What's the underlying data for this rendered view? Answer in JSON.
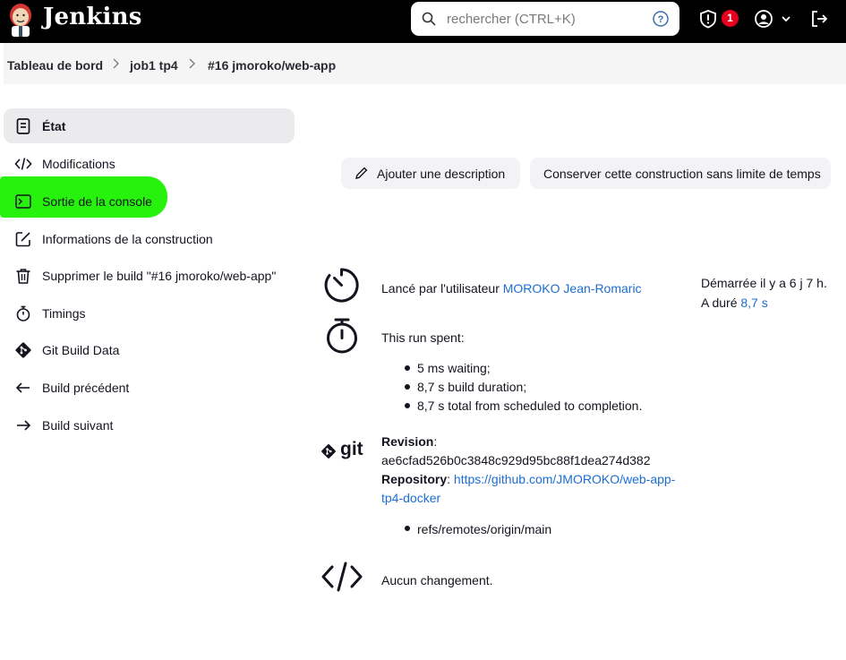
{
  "header": {
    "brand": "Jenkins",
    "search_placeholder": "rechercher (CTRL+K)",
    "security_badge_count": "1"
  },
  "breadcrumb": [
    "Tableau de bord",
    "job1 tp4",
    "#16 jmoroko/web-app"
  ],
  "sidebar": {
    "items": [
      {
        "label": "État",
        "icon": "document-icon"
      },
      {
        "label": "Modifications",
        "icon": "code-icon"
      },
      {
        "label": "Sortie de la console",
        "icon": "terminal-icon"
      },
      {
        "label": "Informations de la construction",
        "icon": "edit-icon"
      },
      {
        "label": "Supprimer le build \"#16 jmoroko/web-app\"",
        "icon": "trash-icon"
      },
      {
        "label": "Timings",
        "icon": "stopwatch-icon"
      },
      {
        "label": "Git Build Data",
        "icon": "git-icon"
      },
      {
        "label": "Build précédent",
        "icon": "arrow-left-icon"
      },
      {
        "label": "Build suivant",
        "icon": "arrow-right-icon"
      }
    ],
    "highlight_color": "#27f20e"
  },
  "actions": {
    "add_description": "Ajouter une description",
    "keep_build": "Conserver cette construction sans limite de temps"
  },
  "build": {
    "launched_by_prefix": "Lancé par l'utilisateur",
    "launched_by_user": "MOROKO Jean-Romaric",
    "started": "Démarrée il y a 6 j 7 h.",
    "duration_prefix": "A duré",
    "duration": "8,7 s",
    "run_spent": "This run spent:",
    "run_items": [
      "5 ms waiting;",
      "8,7 s build duration;",
      "8,7 s total from scheduled to completion."
    ]
  },
  "git": {
    "logo_text": "git",
    "revision_label": "Revision",
    "revision": "ae6cfad526b0c3848c929d95bc88f1dea274d382",
    "repository_label": "Repository",
    "repository_line1": "https://github.com/JMOROKO/web-app-",
    "repository_line2": "tp4-docker",
    "refs": [
      "refs/remotes/origin/main"
    ]
  },
  "changes": {
    "none": "Aucun changement."
  },
  "colors": {
    "link": "#1c6ed4",
    "badge": "#e6001e",
    "header_bg": "#000000"
  }
}
